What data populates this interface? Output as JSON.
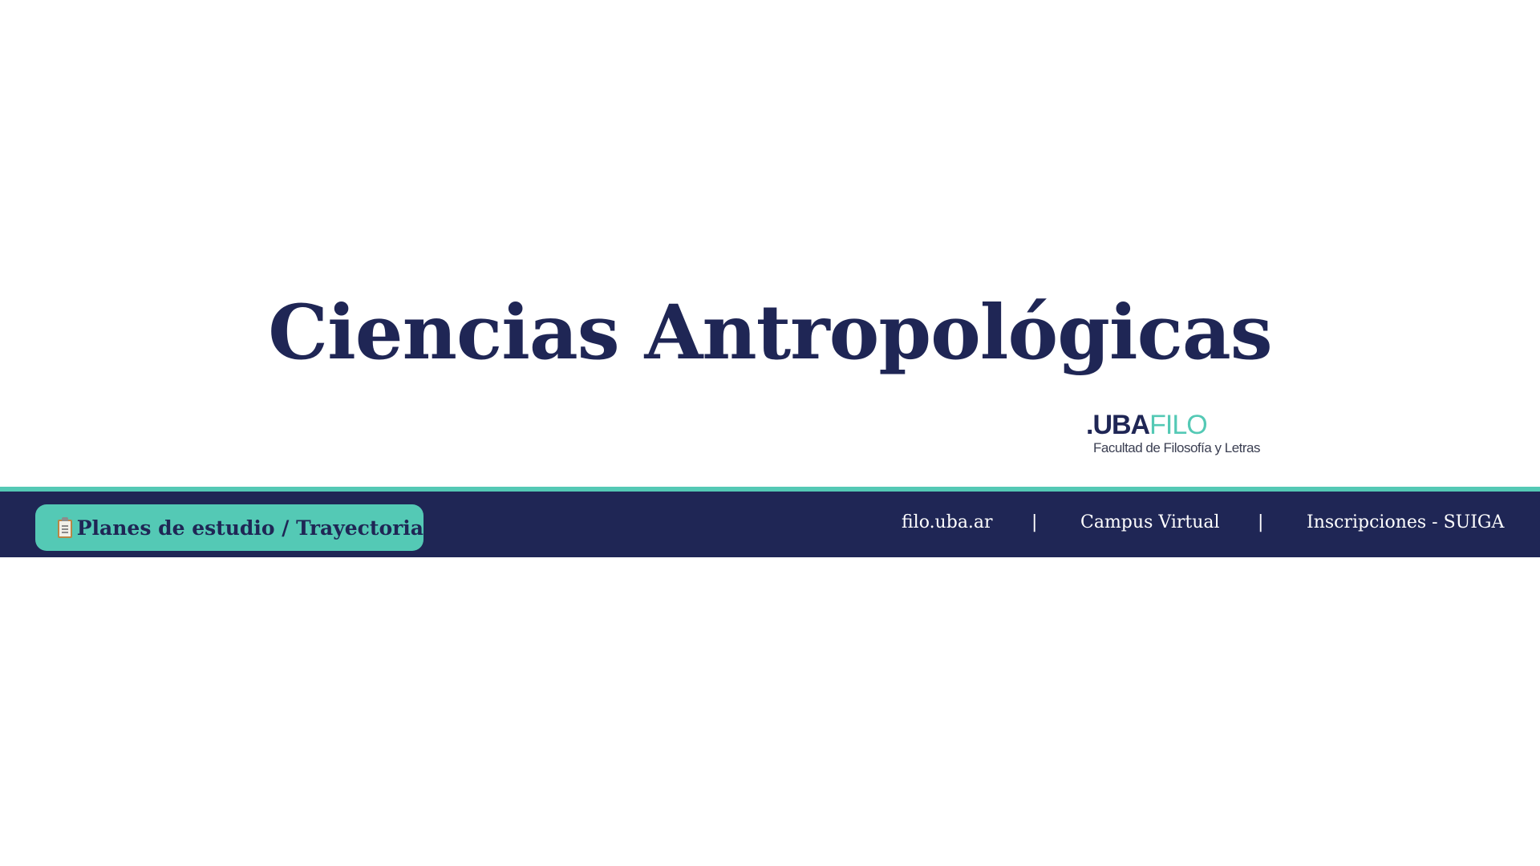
{
  "header": {
    "title": "Ciencias Antropológicas"
  },
  "logo": {
    "text_uba": ".UBA",
    "text_filo": "FILO",
    "subtitle": "Facultad de Filosofía y Letras"
  },
  "navbar": {
    "plans_button": {
      "icon": "clipboard-icon",
      "label": "Planes de estudio / Trayectoria"
    },
    "links": [
      {
        "label": "filo.uba.ar"
      },
      {
        "label": "Campus Virtual"
      },
      {
        "label": "Inscripciones - SUIGA"
      }
    ],
    "separator": "|"
  },
  "colors": {
    "navy": "#1f2655",
    "teal": "#54c9b5",
    "background": "#ffffff"
  }
}
